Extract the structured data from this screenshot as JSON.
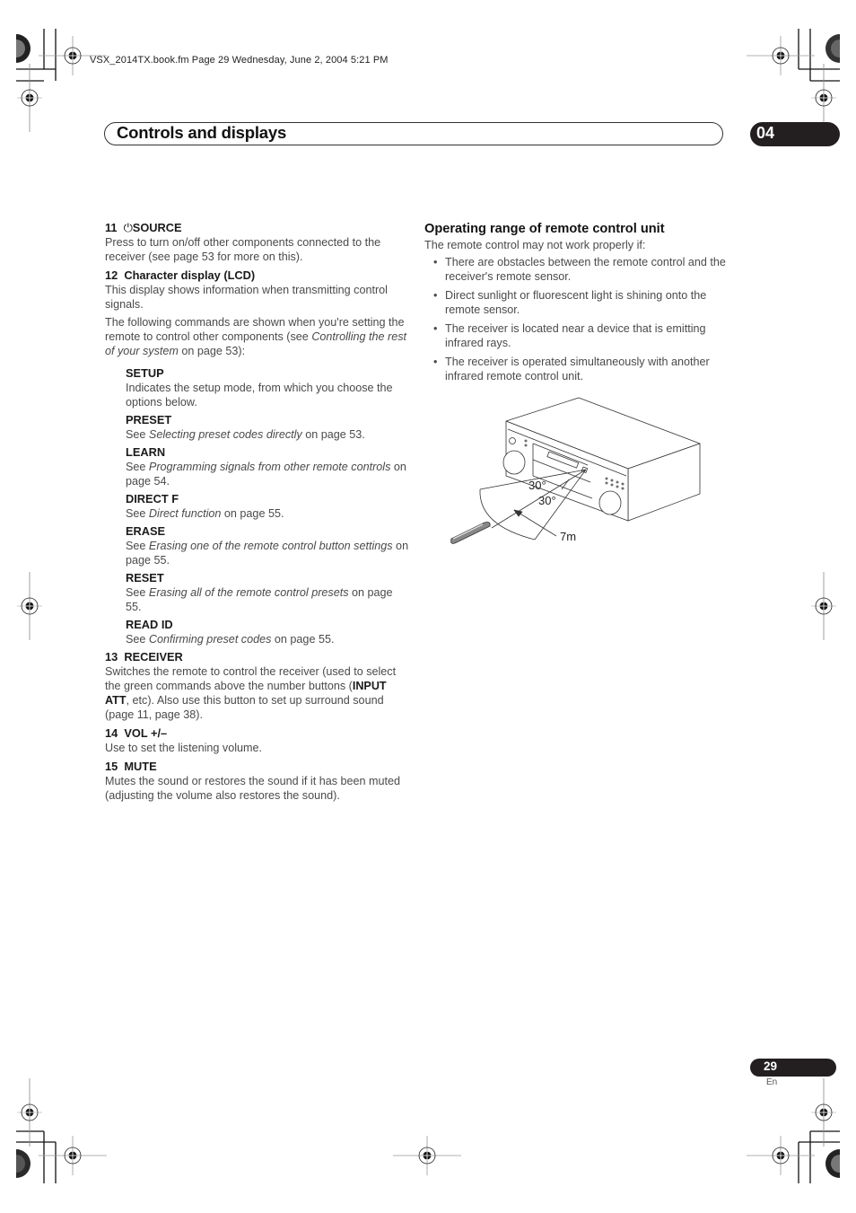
{
  "header": {
    "slug": "VSX_2014TX.book.fm  Page 29  Wednesday, June 2, 2004  5:21 PM",
    "chapter_title": "Controls and displays",
    "chapter_number": "04"
  },
  "left_column": {
    "item11": {
      "number": "11",
      "icon": "power-icon",
      "label": "SOURCE",
      "text": "Press to turn on/off other components connected to the receiver (see page 53 for more on this)."
    },
    "item12": {
      "number": "12",
      "label": "Character display (LCD)",
      "text1": "This display shows information when transmitting control signals.",
      "text2_pre": "The following commands are shown when you're setting the remote to control other components (see ",
      "text2_link": "Controlling the rest of your system",
      "text2_post": " on page 53):"
    },
    "commands": [
      {
        "label": "SETUP",
        "pre": "Indicates the setup mode, from which you choose the options below.",
        "ital": "",
        "post": ""
      },
      {
        "label": "PRESET",
        "pre": "See ",
        "ital": "Selecting preset codes directly",
        "post": " on page 53."
      },
      {
        "label": "LEARN",
        "pre": "See ",
        "ital": "Programming signals from other remote controls",
        "post": " on page 54."
      },
      {
        "label": "DIRECT F",
        "pre": "See ",
        "ital": "Direct function",
        "post": " on page 55."
      },
      {
        "label": "ERASE",
        "pre": "See ",
        "ital": "Erasing one of the remote control button settings",
        "post": " on page 55."
      },
      {
        "label": "RESET",
        "pre": "See ",
        "ital": "Erasing all of the remote control presets",
        "post": " on page 55."
      },
      {
        "label": "READ ID",
        "pre": "See ",
        "ital": "Confirming preset codes",
        "post": " on page 55."
      }
    ],
    "item13": {
      "number": "13",
      "label": "RECEIVER",
      "text_pre": "Switches the remote to control the receiver (used to select the green commands above the number buttons (",
      "text_bold": "INPUT ATT",
      "text_post": ", etc). Also use this button to set up surround sound (page 11, page 38)."
    },
    "item14": {
      "number": "14",
      "label": "VOL +/–",
      "text": "Use to set the listening volume."
    },
    "item15": {
      "number": "15",
      "label": "MUTE",
      "text": "Mutes the sound or restores the sound if it has been muted (adjusting the volume also restores the sound)."
    }
  },
  "right_column": {
    "title": "Operating range of remote control unit",
    "intro": "The remote control may not work properly if:",
    "bullets": [
      "There are obstacles between the remote control and the receiver's remote sensor.",
      "Direct sunlight or fluorescent light is shining onto the remote sensor.",
      "The receiver is located near a device that is emitting infrared rays.",
      "The receiver is operated simultaneously with another infrared remote control unit."
    ],
    "diagram": {
      "angle_upper": "30°",
      "angle_lower": "30°",
      "distance": "7m"
    }
  },
  "footer": {
    "page_number": "29",
    "language": "En"
  }
}
